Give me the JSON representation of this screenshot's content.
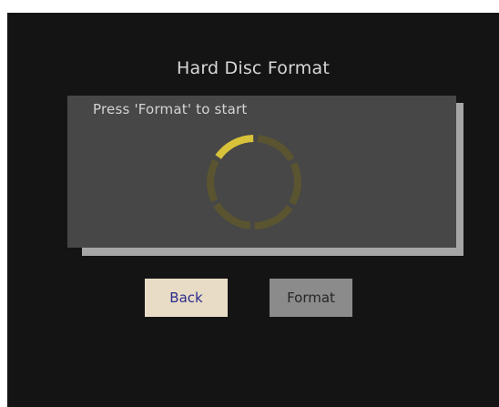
{
  "dialog": {
    "title": "Hard Disc Format",
    "prompt": "Press 'Format' to start"
  },
  "progress": {
    "segments_total": 6,
    "segments_active": 1
  },
  "buttons": {
    "back_label": "Back",
    "format_label": "Format"
  },
  "colors": {
    "screen_bg": "#141414",
    "panel_bg": "#474747",
    "panel_shadow": "#a6a6a6",
    "spinner_active": "#d8c23a",
    "spinner_inactive": "#5a5430",
    "back_button_bg": "#e8dcc6",
    "format_button_bg": "#8b8b8b"
  }
}
